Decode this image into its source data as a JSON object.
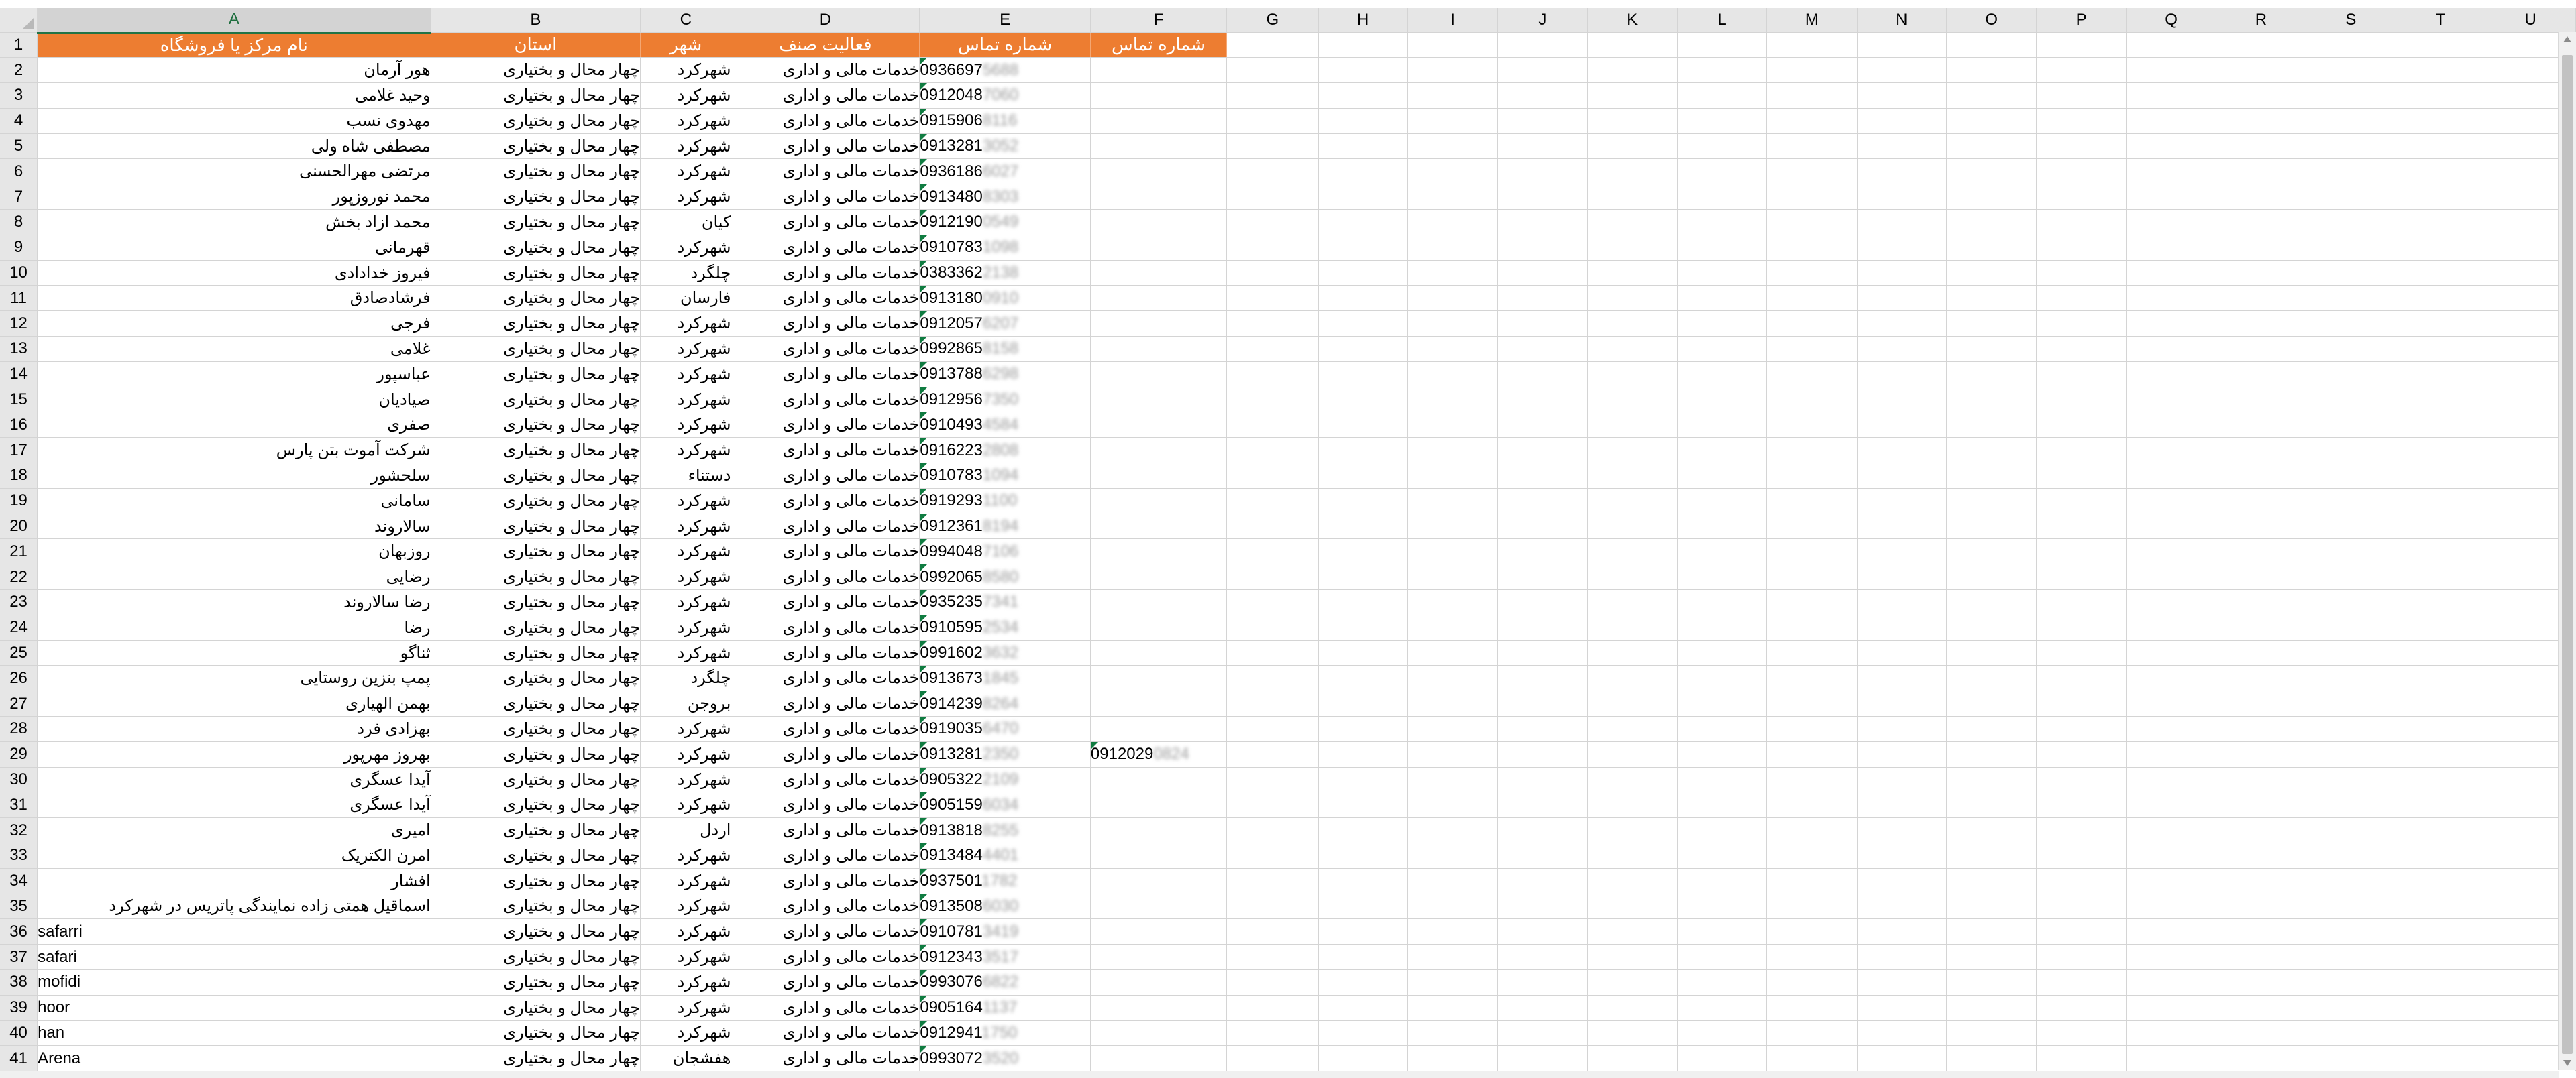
{
  "columns": [
    "A",
    "B",
    "C",
    "D",
    "E",
    "F",
    "G",
    "H",
    "I",
    "J",
    "K",
    "L",
    "M",
    "N",
    "O",
    "P",
    "Q",
    "R",
    "S",
    "T",
    "U"
  ],
  "selected_column": "A",
  "header_row": {
    "number": "1",
    "cells": [
      "نام مرکز یا فروشگاه",
      "استان",
      "شهر",
      "فعالیت صنف",
      "شماره تماس",
      "شماره تماس"
    ]
  },
  "header_fill_color": "#ed7d31",
  "flag_color": "#107c41",
  "rows": [
    {
      "n": "2",
      "name": "هور آرمان",
      "province": "چهار محال و بختیاری",
      "city": "شهرکرد",
      "activity": "خدمات مالی و اداری",
      "phone": "0936697",
      "phone_hidden": "5688",
      "phone2": "",
      "phone2_hidden": ""
    },
    {
      "n": "3",
      "name": "وحید غلامی",
      "province": "چهار محال و بختیاری",
      "city": "شهرکرد",
      "activity": "خدمات مالی و اداری",
      "phone": "0912048",
      "phone_hidden": "7060",
      "phone2": "",
      "phone2_hidden": ""
    },
    {
      "n": "4",
      "name": "مهدوی نسب",
      "province": "چهار محال و بختیاری",
      "city": "شهرکرد",
      "activity": "خدمات مالی و اداری",
      "phone": "0915906",
      "phone_hidden": "8116",
      "phone2": "",
      "phone2_hidden": ""
    },
    {
      "n": "5",
      "name": "مصطفی شاه ولی",
      "province": "چهار محال و بختیاری",
      "city": "شهرکرد",
      "activity": "خدمات مالی و اداری",
      "phone": "0913281",
      "phone_hidden": "3052",
      "phone2": "",
      "phone2_hidden": ""
    },
    {
      "n": "6",
      "name": "مرتضی مهرالحسنی",
      "province": "چهار محال و بختیاری",
      "city": "شهرکرد",
      "activity": "خدمات مالی و اداری",
      "phone": "0936186",
      "phone_hidden": "6027",
      "phone2": "",
      "phone2_hidden": ""
    },
    {
      "n": "7",
      "name": "محمد نوروزپور",
      "province": "چهار محال و بختیاری",
      "city": "شهرکرد",
      "activity": "خدمات مالی و اداری",
      "phone": "0913480",
      "phone_hidden": "8303",
      "phone2": "",
      "phone2_hidden": ""
    },
    {
      "n": "8",
      "name": "محمد ازاد بخش",
      "province": "چهار محال و بختیاری",
      "city": "کیان",
      "activity": "خدمات مالی و اداری",
      "phone": "0912190",
      "phone_hidden": "0549",
      "phone2": "",
      "phone2_hidden": ""
    },
    {
      "n": "9",
      "name": "قهرمانی",
      "province": "چهار محال و بختیاری",
      "city": "شهرکرد",
      "activity": "خدمات مالی و اداری",
      "phone": "0910783",
      "phone_hidden": "1098",
      "phone2": "",
      "phone2_hidden": ""
    },
    {
      "n": "10",
      "name": "فیروز خدادادی",
      "province": "چهار محال و بختیاری",
      "city": "چلگرد",
      "activity": "خدمات مالی و اداری",
      "phone": "0383362",
      "phone_hidden": "2138",
      "phone2": "",
      "phone2_hidden": ""
    },
    {
      "n": "11",
      "name": "فرشادصادق",
      "province": "چهار محال و بختیاری",
      "city": "فارسان",
      "activity": "خدمات مالی و اداری",
      "phone": "0913180",
      "phone_hidden": "0910",
      "phone2": "",
      "phone2_hidden": ""
    },
    {
      "n": "12",
      "name": "فرجی",
      "province": "چهار محال و بختیاری",
      "city": "شهرکرد",
      "activity": "خدمات مالی و اداری",
      "phone": "0912057",
      "phone_hidden": "6207",
      "phone2": "",
      "phone2_hidden": ""
    },
    {
      "n": "13",
      "name": "غلامی",
      "province": "چهار محال و بختیاری",
      "city": "شهرکرد",
      "activity": "خدمات مالی و اداری",
      "phone": "0992865",
      "phone_hidden": "8158",
      "phone2": "",
      "phone2_hidden": ""
    },
    {
      "n": "14",
      "name": "عباسپور",
      "province": "چهار محال و بختیاری",
      "city": "شهرکرد",
      "activity": "خدمات مالی و اداری",
      "phone": "0913788",
      "phone_hidden": "6298",
      "phone2": "",
      "phone2_hidden": ""
    },
    {
      "n": "15",
      "name": "صیادیان",
      "province": "چهار محال و بختیاری",
      "city": "شهرکرد",
      "activity": "خدمات مالی و اداری",
      "phone": "0912956",
      "phone_hidden": "7350",
      "phone2": "",
      "phone2_hidden": ""
    },
    {
      "n": "16",
      "name": "صفری",
      "province": "چهار محال و بختیاری",
      "city": "شهرکرد",
      "activity": "خدمات مالی و اداری",
      "phone": "0910493",
      "phone_hidden": "4584",
      "phone2": "",
      "phone2_hidden": ""
    },
    {
      "n": "17",
      "name": "شرکت آموت بتن پارس",
      "province": "چهار محال و بختیاری",
      "city": "شهرکرد",
      "activity": "خدمات مالی و اداری",
      "phone": "0916223",
      "phone_hidden": "2808",
      "phone2": "",
      "phone2_hidden": ""
    },
    {
      "n": "18",
      "name": "سلحشور",
      "province": "چهار محال و بختیاری",
      "city": "دستناء",
      "activity": "خدمات مالی و اداری",
      "phone": "0910783",
      "phone_hidden": "1094",
      "phone2": "",
      "phone2_hidden": ""
    },
    {
      "n": "19",
      "name": "سامانی",
      "province": "چهار محال و بختیاری",
      "city": "شهرکرد",
      "activity": "خدمات مالی و اداری",
      "phone": "0919293",
      "phone_hidden": "1100",
      "phone2": "",
      "phone2_hidden": ""
    },
    {
      "n": "20",
      "name": "سالاروند",
      "province": "چهار محال و بختیاری",
      "city": "شهرکرد",
      "activity": "خدمات مالی و اداری",
      "phone": "0912361",
      "phone_hidden": "8194",
      "phone2": "",
      "phone2_hidden": ""
    },
    {
      "n": "21",
      "name": "روزبهان",
      "province": "چهار محال و بختیاری",
      "city": "شهرکرد",
      "activity": "خدمات مالی و اداری",
      "phone": "0994048",
      "phone_hidden": "7106",
      "phone2": "",
      "phone2_hidden": ""
    },
    {
      "n": "22",
      "name": "رضایی",
      "province": "چهار محال و بختیاری",
      "city": "شهرکرد",
      "activity": "خدمات مالی و اداری",
      "phone": "0992065",
      "phone_hidden": "8580",
      "phone2": "",
      "phone2_hidden": ""
    },
    {
      "n": "23",
      "name": "رضا سالاروند",
      "province": "چهار محال و بختیاری",
      "city": "شهرکرد",
      "activity": "خدمات مالی و اداری",
      "phone": "0935235",
      "phone_hidden": "7341",
      "phone2": "",
      "phone2_hidden": ""
    },
    {
      "n": "24",
      "name": "رضا",
      "province": "چهار محال و بختیاری",
      "city": "شهرکرد",
      "activity": "خدمات مالی و اداری",
      "phone": "0910595",
      "phone_hidden": "2534",
      "phone2": "",
      "phone2_hidden": ""
    },
    {
      "n": "25",
      "name": "ثناگو",
      "province": "چهار محال و بختیاری",
      "city": "شهرکرد",
      "activity": "خدمات مالی و اداری",
      "phone": "0991602",
      "phone_hidden": "3632",
      "phone2": "",
      "phone2_hidden": ""
    },
    {
      "n": "26",
      "name": "پمپ بنزین روستایی",
      "province": "چهار محال و بختیاری",
      "city": "چلگرد",
      "activity": "خدمات مالی و اداری",
      "phone": "0913673",
      "phone_hidden": "1845",
      "phone2": "",
      "phone2_hidden": ""
    },
    {
      "n": "27",
      "name": "بهمن الهیاری",
      "province": "چهار محال و بختیاری",
      "city": "بروجن",
      "activity": "خدمات مالی و اداری",
      "phone": "0914239",
      "phone_hidden": "8264",
      "phone2": "",
      "phone2_hidden": ""
    },
    {
      "n": "28",
      "name": "بهزادی فرد",
      "province": "چهار محال و بختیاری",
      "city": "شهرکرد",
      "activity": "خدمات مالی و اداری",
      "phone": "0919035",
      "phone_hidden": "6470",
      "phone2": "",
      "phone2_hidden": ""
    },
    {
      "n": "29",
      "name": "بهروز مهرپور",
      "province": "چهار محال و بختیاری",
      "city": "شهرکرد",
      "activity": "خدمات مالی و اداری",
      "phone": "0913281",
      "phone_hidden": "2350",
      "phone2": "0912029",
      "phone2_hidden": "0824"
    },
    {
      "n": "30",
      "name": "آیدا عسگری",
      "province": "چهار محال و بختیاری",
      "city": "شهرکرد",
      "activity": "خدمات مالی و اداری",
      "phone": "0905322",
      "phone_hidden": "2109",
      "phone2": "",
      "phone2_hidden": ""
    },
    {
      "n": "31",
      "name": "آیدا عسگری",
      "province": "چهار محال و بختیاری",
      "city": "شهرکرد",
      "activity": "خدمات مالی و اداری",
      "phone": "0905159",
      "phone_hidden": "6034",
      "phone2": "",
      "phone2_hidden": ""
    },
    {
      "n": "32",
      "name": "امیری",
      "province": "چهار محال و بختیاری",
      "city": "اردل",
      "activity": "خدمات مالی و اداری",
      "phone": "0913818",
      "phone_hidden": "8255",
      "phone2": "",
      "phone2_hidden": ""
    },
    {
      "n": "33",
      "name": "امرن الکتریک",
      "province": "چهار محال و بختیاری",
      "city": "شهرکرد",
      "activity": "خدمات مالی و اداری",
      "phone": "0913484",
      "phone_hidden": "4401",
      "phone2": "",
      "phone2_hidden": ""
    },
    {
      "n": "34",
      "name": "افشار",
      "province": "چهار محال و بختیاری",
      "city": "شهرکرد",
      "activity": "خدمات مالی و اداری",
      "phone": "0937501",
      "phone_hidden": "1782",
      "phone2": "",
      "phone2_hidden": ""
    },
    {
      "n": "35",
      "name": "اسماقیل همتی زاده نمایندگی پاتریس در شهرکرد",
      "province": "چهار محال و بختیاری",
      "city": "شهرکرد",
      "activity": "خدمات مالی و اداری",
      "phone": "0913508",
      "phone_hidden": "6030",
      "phone2": "",
      "phone2_hidden": ""
    },
    {
      "n": "36",
      "name": "safarri",
      "province": "چهار محال و بختیاری",
      "city": "شهرکرد",
      "activity": "خدمات مالی و اداری",
      "phone": "0910781",
      "phone_hidden": "3419",
      "phone2": "",
      "phone2_hidden": "",
      "latin": true
    },
    {
      "n": "37",
      "name": "safari",
      "province": "چهار محال و بختیاری",
      "city": "شهرکرد",
      "activity": "خدمات مالی و اداری",
      "phone": "0912343",
      "phone_hidden": "3517",
      "phone2": "",
      "phone2_hidden": "",
      "latin": true
    },
    {
      "n": "38",
      "name": "mofidi",
      "province": "چهار محال و بختیاری",
      "city": "شهرکرد",
      "activity": "خدمات مالی و اداری",
      "phone": "0993076",
      "phone_hidden": "6822",
      "phone2": "",
      "phone2_hidden": "",
      "latin": true
    },
    {
      "n": "39",
      "name": "hoor",
      "province": "چهار محال و بختیاری",
      "city": "شهرکرد",
      "activity": "خدمات مالی و اداری",
      "phone": "0905164",
      "phone_hidden": "1137",
      "phone2": "",
      "phone2_hidden": "",
      "latin": true
    },
    {
      "n": "40",
      "name": "han",
      "province": "چهار محال و بختیاری",
      "city": "شهرکرد",
      "activity": "خدمات مالی و اداری",
      "phone": "0912941",
      "phone_hidden": "1750",
      "phone2": "",
      "phone2_hidden": "",
      "latin": true
    },
    {
      "n": "41",
      "name": "Arena",
      "province": "چهار محال و بختیاری",
      "city": "هفشجان",
      "activity": "خدمات مالی و اداری",
      "phone": "0993072",
      "phone_hidden": "3520",
      "phone2": "",
      "phone2_hidden": "",
      "latin": true
    }
  ]
}
